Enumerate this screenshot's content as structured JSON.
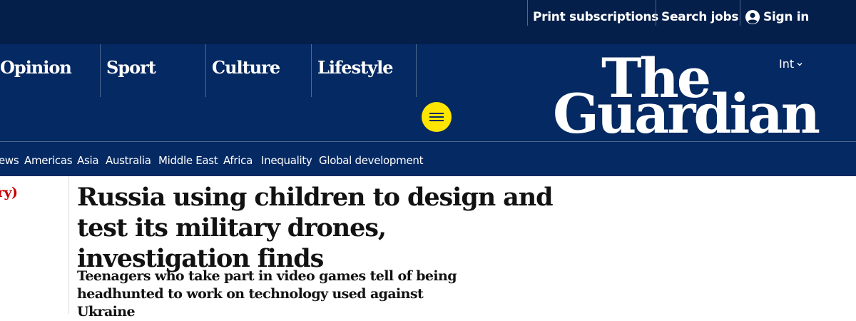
{
  "topbar": {
    "print_subscriptions": "Print subscriptions",
    "search_jobs": "Search jobs",
    "sign_in": "Sign in"
  },
  "edition": {
    "label": "Int"
  },
  "logo": {
    "line1": "The",
    "line2": "Guardian"
  },
  "pillars": [
    "Opinion",
    "Sport",
    "Culture",
    "Lifestyle"
  ],
  "subnav": [
    "ews",
    "Americas",
    "Asia",
    "Australia",
    "Middle East",
    "Africa",
    "Inequality",
    "Global development"
  ],
  "article": {
    "section": "ry)",
    "headline": "Russia using children to design and test its military drones, investigation finds",
    "standfirst": "Teenagers who take part in video games tell of being headhunted to work on technology used against Ukraine"
  },
  "colors": {
    "topbar_bg": "#041f4a",
    "brand_blue": "#052962",
    "menu_yellow": "#ffe500",
    "section_red": "#c70000",
    "text": "#121212"
  },
  "icons": {
    "account": "user-circle-icon",
    "menu": "hamburger-icon",
    "edition": "chevron-down-icon"
  }
}
